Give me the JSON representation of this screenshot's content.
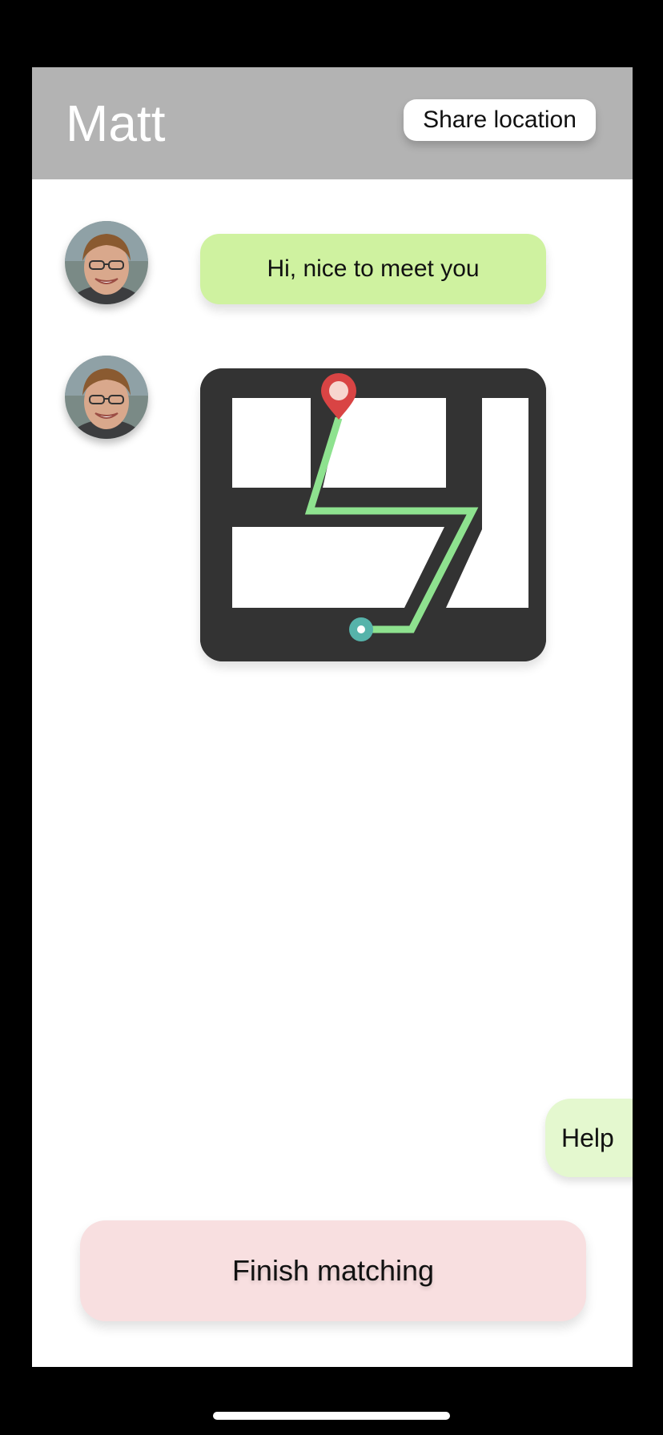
{
  "header": {
    "title": "Matt",
    "share_label": "Share location"
  },
  "messages": [
    {
      "sender_avatar": "avatar-matt",
      "type": "text",
      "text": "Hi, nice to meet you"
    },
    {
      "sender_avatar": "avatar-matt",
      "type": "map",
      "content": "route-map"
    }
  ],
  "actions": {
    "help_label": "Help",
    "finish_label": "Finish matching"
  },
  "colors": {
    "header_bg": "#b3b3b3",
    "bubble_green": "#cff2a0",
    "map_bg": "#333333",
    "route": "#8ee28f",
    "pin_red": "#d94444",
    "start_teal": "#56b3aa",
    "help_bg": "#e4f8cf",
    "finish_bg": "#f8dfe0"
  },
  "icons": [
    "map-pin-icon",
    "start-dot-icon",
    "avatar"
  ]
}
